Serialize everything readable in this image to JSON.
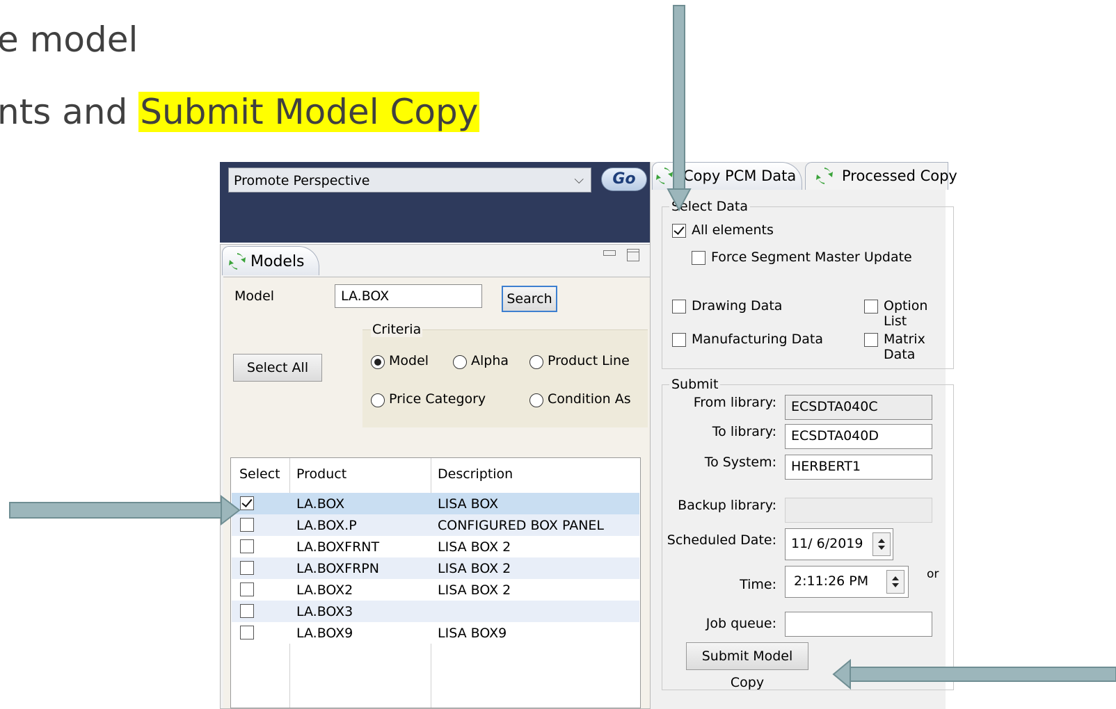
{
  "slide": {
    "line1": "e model",
    "line2_prefix": "nts and ",
    "line2_highlight": "Submit Model Copy"
  },
  "top_bar": {
    "perspective_value": "Promote Perspective",
    "go_label": "Go"
  },
  "models_panel": {
    "tab_label": "Models",
    "model_label": "Model",
    "model_value": "LA.BOX",
    "search_label": "Search",
    "select_all_label": "Select All",
    "criteria_title": "Criteria",
    "criteria_options": [
      "Model",
      "Alpha",
      "Product Line",
      "Price Category",
      "Condition As"
    ],
    "criteria_selected": "Model",
    "table": {
      "headers": [
        "Select",
        "Product",
        "Description"
      ],
      "rows": [
        {
          "checked": true,
          "product": "LA.BOX",
          "description": "LISA BOX"
        },
        {
          "checked": false,
          "product": "LA.BOX.P",
          "description": "CONFIGURED BOX PANEL"
        },
        {
          "checked": false,
          "product": "LA.BOXFRNT",
          "description": "LISA BOX 2"
        },
        {
          "checked": false,
          "product": "LA.BOXFRPN",
          "description": "LISA BOX 2"
        },
        {
          "checked": false,
          "product": "LA.BOX2",
          "description": "LISA BOX 2"
        },
        {
          "checked": false,
          "product": "LA.BOX3",
          "description": ""
        },
        {
          "checked": false,
          "product": "LA.BOX9",
          "description": "LISA BOX9"
        }
      ]
    }
  },
  "copy_panel": {
    "tabs": [
      "Copy PCM Data",
      "Processed Copy"
    ],
    "select_data": {
      "title": "Select Data",
      "all_elements": "All elements",
      "all_elements_checked": true,
      "force_segment": "Force Segment Master Update",
      "drawing_data": "Drawing Data",
      "option_list": "Option List",
      "manufacturing_data": "Manufacturing Data",
      "matrix_data": "Matrix Data"
    },
    "submit": {
      "title": "Submit",
      "from_library_label": "From library:",
      "from_library_value": "ECSDTA040C",
      "to_library_label": "To library:",
      "to_library_value": "ECSDTA040D",
      "to_system_label": "To System:",
      "to_system_value": "HERBERT1",
      "backup_library_label": "Backup library:",
      "backup_library_value": "",
      "scheduled_date_label": "Scheduled Date:",
      "scheduled_date_value": "11/  6/2019",
      "time_label": "Time:",
      "time_value": "2:11:26 PM",
      "or_label": "or",
      "job_queue_label": "Job queue:",
      "job_queue_value": "",
      "submit_button": "Submit Model Copy"
    }
  },
  "colors": {
    "top_bar": "#2e3a5c",
    "highlight": "#ffff00",
    "row_selected": "#c9def2",
    "arrow": "#9cb6bb"
  }
}
